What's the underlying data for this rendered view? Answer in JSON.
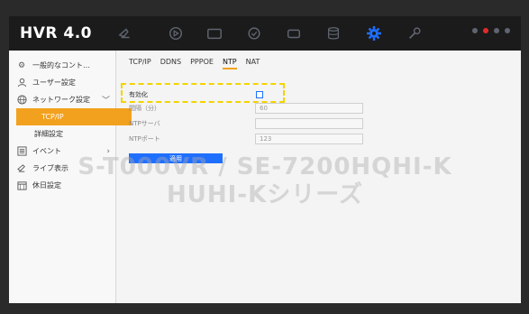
{
  "header": {
    "logo": "HVR 4.0"
  },
  "top_icons": [
    "live-view-icon",
    "playback-icon",
    "file-icon",
    "smart-icon",
    "device-icon",
    "storage-icon",
    "settings-icon",
    "maintenance-icon"
  ],
  "sidebar": {
    "items": [
      {
        "label": "一般的なコント…",
        "icon": "gear-icon"
      },
      {
        "label": "ユーザー設定",
        "icon": "user-icon"
      },
      {
        "label": "ネットワーク設定",
        "icon": "globe-icon"
      },
      {
        "label": "TCP/IP",
        "icon": ""
      },
      {
        "label": "詳細設定",
        "icon": ""
      },
      {
        "label": "イベント",
        "icon": "event-icon"
      },
      {
        "label": "ライブ表示",
        "icon": "camera-icon"
      },
      {
        "label": "休日設定",
        "icon": "calendar-icon"
      }
    ]
  },
  "tabs": [
    "TCP/IP",
    "DDNS",
    "PPPOE",
    "NTP",
    "NAT"
  ],
  "form": {
    "enable_label": "有効化",
    "interval_label": "間隔（分）",
    "interval_value": "60",
    "ntp_server_label": "NTPサーバ",
    "ntp_server_value": "",
    "ntp_port_label": "NTPポート",
    "ntp_port_value": "123",
    "apply_label": "適用"
  },
  "watermark": {
    "line1": "S-T000VR / SE-7200HQHI-K",
    "line2": "HUHI-Kシリーズ"
  },
  "colors": {
    "accent": "#f2a11e",
    "primary": "#1f6fff",
    "highlight": "#f2d400"
  }
}
